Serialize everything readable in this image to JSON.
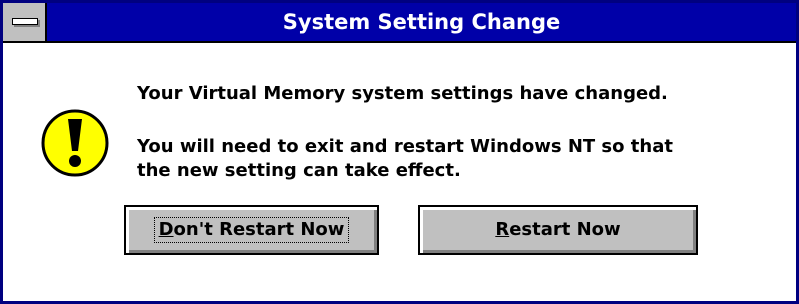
{
  "dialog": {
    "title": "System Setting Change",
    "icon": "exclamation-icon",
    "message_line1": "Your Virtual Memory system settings have changed.",
    "message_line2": "You will need to exit and restart Windows NT so that",
    "message_line3": "the new setting can take effect."
  },
  "buttons": {
    "dont_restart": {
      "mnemonic": "D",
      "rest": "on't Restart Now"
    },
    "restart": {
      "mnemonic": "R",
      "rest": "estart Now"
    }
  },
  "colors": {
    "titlebar": "#0000a8",
    "button_face": "#c0c0c0",
    "icon_fill": "#ffff00"
  }
}
